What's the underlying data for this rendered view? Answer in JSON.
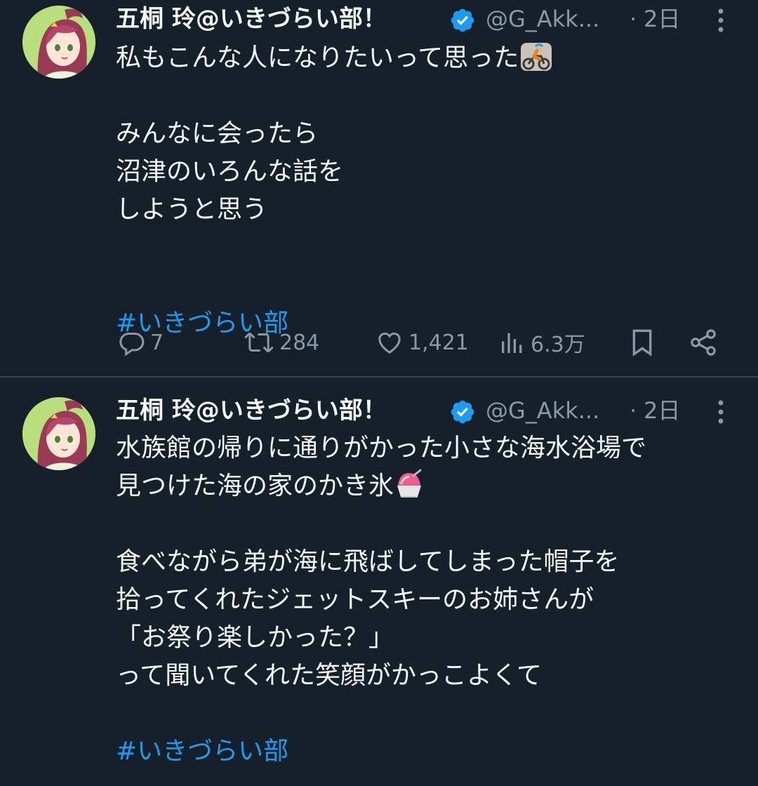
{
  "tweets": [
    {
      "author_name": "五桐 玲@いきづらい部！",
      "handle": "@G_Akk...",
      "separator": "·",
      "time": "2日",
      "text_lines": [
        "私もこんな人になりたいって思った",
        "",
        "みんなに会ったら",
        "沼津のいろんな話を",
        "しようと思う",
        "",
        ""
      ],
      "emoji_after_line_0": "person-biking-emoji",
      "hashtag": "#いきづらい部",
      "replies": "7",
      "retweets": "284",
      "likes": "1,421",
      "views": "6.3万"
    },
    {
      "author_name": "五桐 玲@いきづらい部！",
      "handle": "@G_Akk...",
      "separator": "·",
      "time": "2日",
      "text_lines": [
        "水族館の帰りに通りがかった小さな海水浴場で",
        "見つけた海の家のかき氷",
        "",
        "食べながら弟が海に飛ばしてしまった帽子を",
        "拾ってくれたジェットスキーのお姉さんが",
        "「お祭り楽しかった？」",
        "って聞いてくれた笑顔がかっこよくて",
        ""
      ],
      "emoji_after_line_1": "shaved-ice-emoji",
      "hashtag": "#いきづらい部"
    }
  ],
  "colors": {
    "background": "#15202b",
    "text": "#f7f9f9",
    "muted": "#8b98a5",
    "accent": "#1d9bf0",
    "divider": "#38444d"
  }
}
